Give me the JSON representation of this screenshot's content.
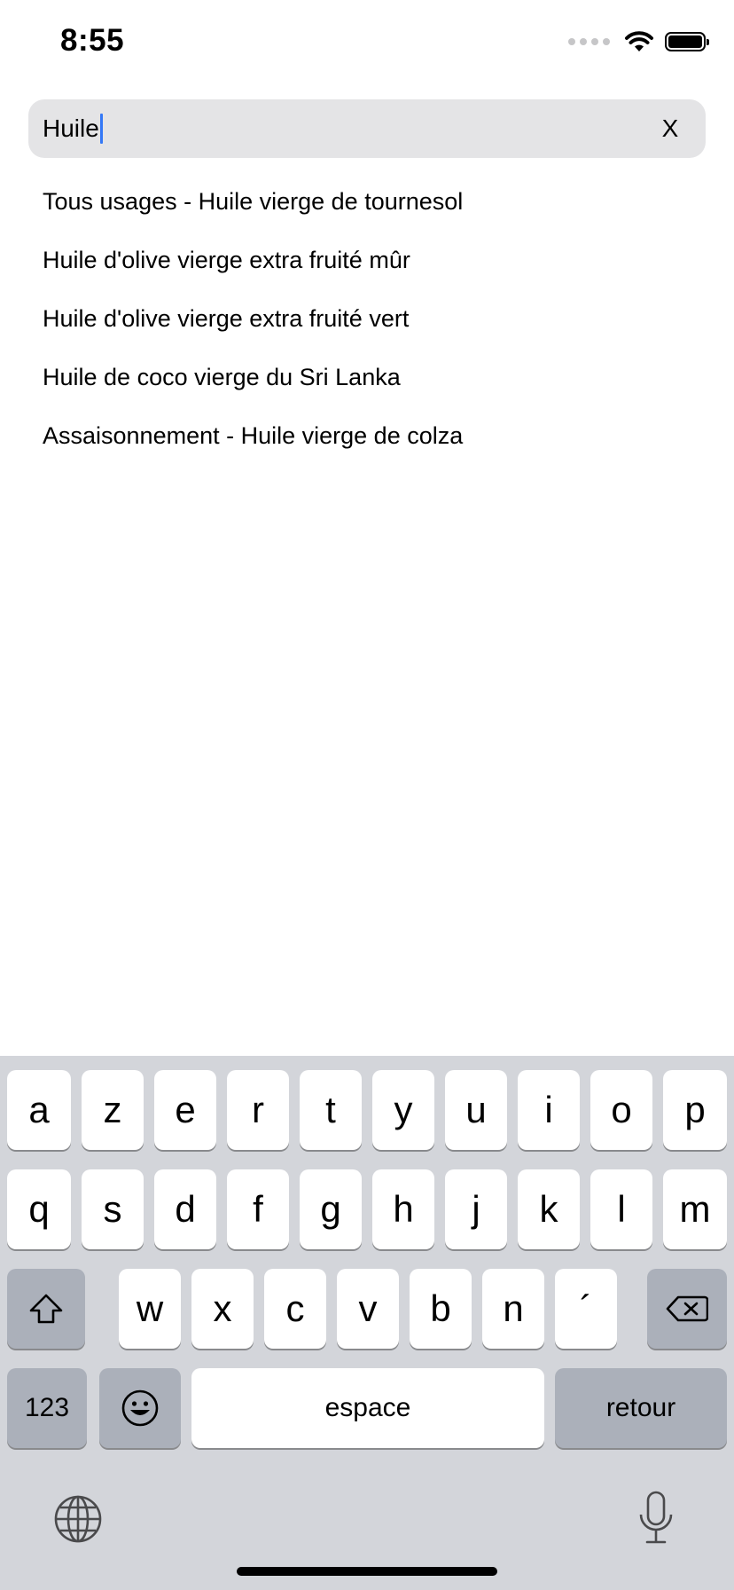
{
  "status_bar": {
    "time": "8:55",
    "icons": [
      "cellular-signal-icon",
      "wifi-icon",
      "battery-icon"
    ]
  },
  "search": {
    "value": "Huile",
    "clear_label": "X"
  },
  "suggestions": [
    "Tous usages - Huile vierge de tournesol",
    "Huile d'olive vierge extra fruité mûr",
    "Huile d'olive vierge extra fruité vert",
    "Huile de coco vierge du Sri Lanka",
    "Assaisonnement - Huile vierge de colza"
  ],
  "keyboard": {
    "row1": [
      "a",
      "z",
      "e",
      "r",
      "t",
      "y",
      "u",
      "i",
      "o",
      "p"
    ],
    "row2": [
      "q",
      "s",
      "d",
      "f",
      "g",
      "h",
      "j",
      "k",
      "l",
      "m"
    ],
    "row3": [
      "w",
      "x",
      "c",
      "v",
      "b",
      "n",
      "´"
    ],
    "numbers_label": "123",
    "space_label": "espace",
    "return_label": "retour",
    "icons": [
      "shift-icon",
      "backspace-icon",
      "emoji-icon",
      "globe-icon",
      "microphone-icon"
    ]
  },
  "colors": {
    "caret": "#3478f6",
    "search_background": "#e4e4e6",
    "keyboard_background": "#d3d5da",
    "key_background": "#ffffff",
    "special_key_background": "#abb0ba"
  }
}
